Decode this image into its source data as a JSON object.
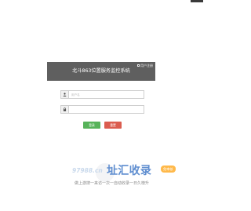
{
  "header": {
    "title": "北斗863位置服务监控系统",
    "register_link": "用户注册"
  },
  "form": {
    "username_placeholder": "用户名",
    "password_placeholder": "",
    "login_label": "登录",
    "reset_label": "重置"
  },
  "colors": {
    "header_bg": "#5f5f5f",
    "login_button": "#57b35a",
    "reset_button": "#db5d4f",
    "watermark_brand": "#5f8ed0",
    "watermark_badge": "#ffb94a"
  },
  "icons": {
    "username": "user-icon",
    "password": "lock-icon",
    "register": "register-icon"
  },
  "watermark": {
    "domain": "97988.cn",
    "brand": "址汇收录",
    "badge": "免审核",
    "slogan": "做上游搜一来访一次一自动收录一日久榜升"
  }
}
